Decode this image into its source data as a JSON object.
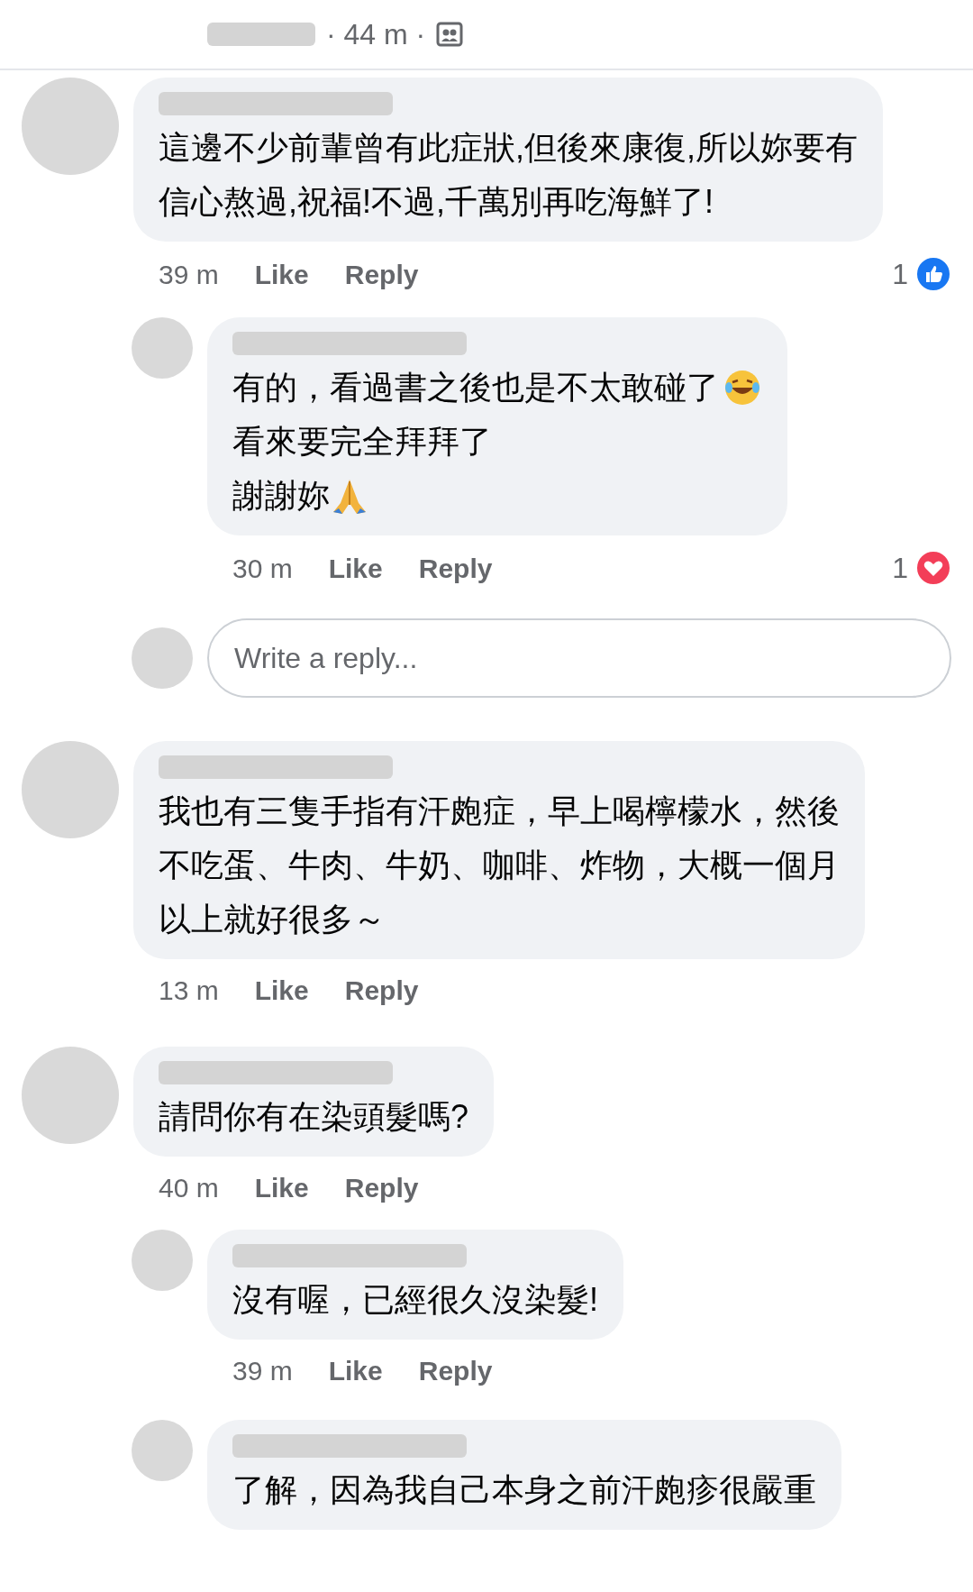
{
  "post_header": {
    "time": "· 44 m ·"
  },
  "comments": [
    {
      "lines": [
        {
          "text": "這邊不少前輩曾有此症狀,但後來康復,所以妳要有"
        },
        {
          "text": "信心熬過,祝福!不過,千萬別再吃海鮮了!"
        }
      ],
      "time": "39 m",
      "like": "Like",
      "reply": "Reply",
      "reaction": {
        "kind": "like",
        "count": "1"
      },
      "children": [
        {
          "lines": [
            {
              "kind": "laugh",
              "text": "有的，看過書之後也是不太敢碰了"
            },
            {
              "text": "看來要完全拜拜了"
            },
            {
              "kind": "pray",
              "text": "謝謝妳"
            }
          ],
          "time": "30 m",
          "like": "Like",
          "reply": "Reply",
          "reaction": {
            "kind": "love",
            "count": "1"
          }
        }
      ],
      "reply_box": {
        "placeholder": "Write a reply..."
      }
    },
    {
      "lines": [
        {
          "text": "我也有三隻手指有汗皰症，早上喝檸檬水，然後"
        },
        {
          "text": "不吃蛋、牛肉、牛奶、咖啡、炸物，大概一個月"
        },
        {
          "text": "以上就好很多～"
        }
      ],
      "time": "13 m",
      "like": "Like",
      "reply": "Reply"
    },
    {
      "lines": [
        {
          "text": "請問你有在染頭髮嗎?"
        }
      ],
      "time": "40 m",
      "like": "Like",
      "reply": "Reply",
      "children": [
        {
          "lines": [
            {
              "text": "沒有喔，已經很久沒染髮!"
            }
          ],
          "time": "39 m",
          "like": "Like",
          "reply": "Reply"
        },
        {
          "lines": [
            {
              "text": "了解，因為我自己本身之前汗皰疹很嚴重"
            }
          ]
        }
      ]
    }
  ]
}
